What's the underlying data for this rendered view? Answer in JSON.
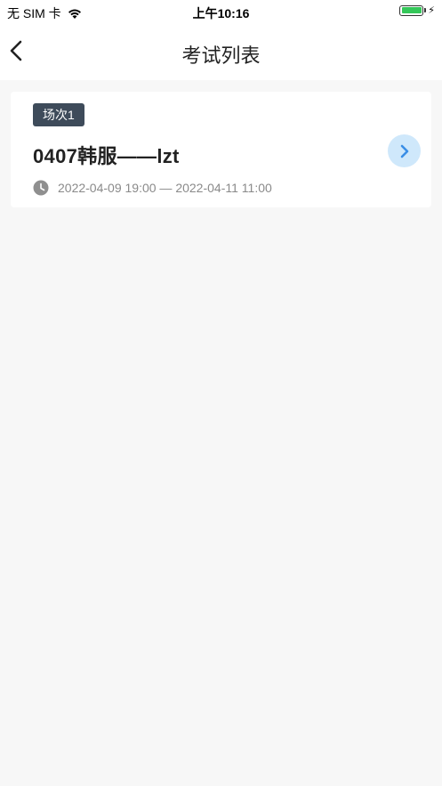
{
  "status_bar": {
    "carrier": "无 SIM 卡",
    "time": "上午10:16",
    "icons": [
      "wifi-icon",
      "battery-icon",
      "charging-icon"
    ]
  },
  "nav": {
    "title": "考试列表",
    "back_icon": "chevron-left-icon"
  },
  "exams": [
    {
      "badge": "场次1",
      "title": "0407韩服——lzt",
      "time_range": "2022-04-09 19:00 — 2022-04-11 11:00",
      "clock_icon": "clock-icon",
      "arrow_icon": "chevron-right-icon"
    }
  ],
  "colors": {
    "background": "#f7f7f7",
    "badge_bg": "#3e4b5a",
    "arrow_bg": "#cfe8fb",
    "arrow_fg": "#3a8ee6",
    "muted_text": "#8a8a8a",
    "battery": "#34c759"
  }
}
